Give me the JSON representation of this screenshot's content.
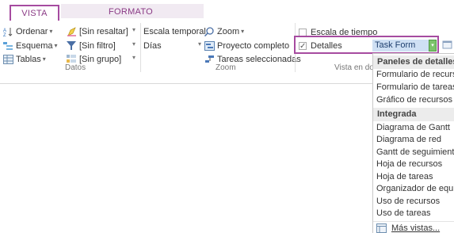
{
  "tabs": {
    "vista": "VISTA",
    "formato": "FORMATO"
  },
  "datos_group": {
    "ordenar": "Ordenar",
    "esquema": "Esquema",
    "tablas": "Tablas",
    "resaltar": "[Sin resaltar]",
    "filtro": "[Sin filtro]",
    "grupo": "[Sin grupo]",
    "label": "Datos"
  },
  "zoom_group": {
    "escala_temporal": "Escala temporal:",
    "escala_value": "Días",
    "zoom": "Zoom",
    "proyecto_completo": "Proyecto completo",
    "tareas_seleccionadas": "Tareas seleccionadas",
    "label": "Zoom"
  },
  "vista_dos_group": {
    "escala_de_tiempo": "Escala de tiempo",
    "detalles": "Detalles",
    "detalles_checked": true,
    "escala_checked": false,
    "selected_view": "Task Form",
    "label": "Vista en dos"
  },
  "menu": {
    "header_paneles": "Paneles de detalles",
    "paneles_items": [
      "Formulario de recursos",
      "Formulario de tareas",
      "Gráfico de recursos"
    ],
    "header_integrada": "Integrada",
    "integrada_items": [
      "Diagrama de Gantt",
      "Diagrama de red",
      "Gantt de seguimiento",
      "Hoja de recursos",
      "Hoja de tareas",
      "Organizador de equipo",
      "Uso de recursos",
      "Uso de tareas"
    ],
    "more_views": "Más vistas..."
  },
  "colors": {
    "accent_purple": "#a64ba0",
    "selection_blue": "#cfe0f4",
    "tab_fill": "#f1eaf2"
  }
}
